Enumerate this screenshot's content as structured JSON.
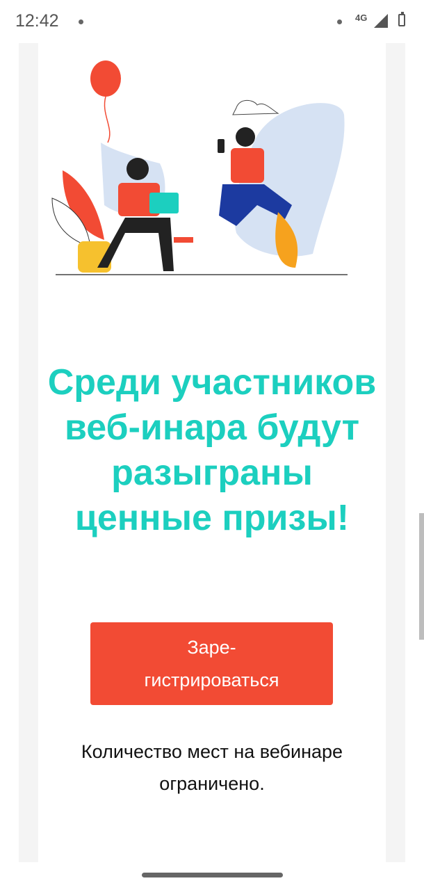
{
  "status_bar": {
    "time": "12:42",
    "network": "4G"
  },
  "main": {
    "heading": "Среди участников веб-инара будут разыграны ценные призы!",
    "register_button": "Заре-гистрироваться",
    "note": "Количество мест на вебинаре ограничено."
  },
  "colors": {
    "accent": "#1ccfbf",
    "button": "#f24b34"
  }
}
